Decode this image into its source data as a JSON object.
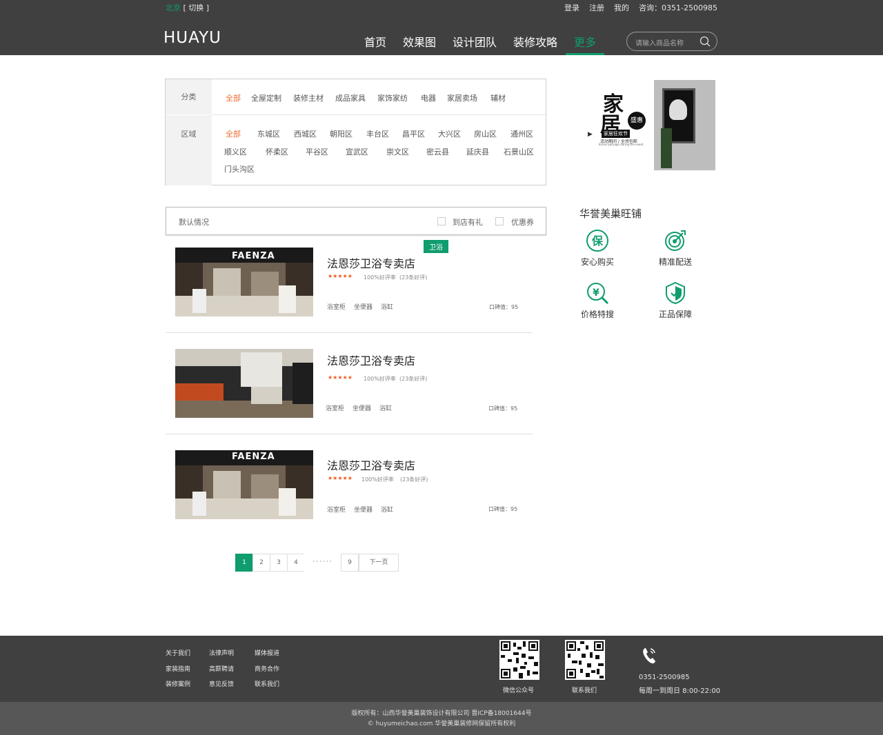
{
  "topbar": {
    "city": "北京",
    "switch": "[ 切换 ]",
    "login": "登录",
    "register": "注册",
    "mine": "我的",
    "phone": "咨询：0351-2500985"
  },
  "header": {
    "logo": "HUAYU",
    "nav": [
      "首页",
      "效果图",
      "设计团队",
      "装修攻略",
      "更多"
    ],
    "search_placeholder": "请输入商品名称"
  },
  "filter": {
    "category_label": "分类",
    "categories": [
      "全部",
      "全屋定制",
      "装修主材",
      "成品家具",
      "家饰家纺",
      "电器",
      "家居卖场",
      "辅材"
    ],
    "area_label": "区域",
    "areas": [
      "全部",
      "东城区",
      "西城区",
      "朝阳区",
      "丰台区",
      "昌平区",
      "大兴区",
      "房山区",
      "通州区",
      "顺义区",
      "怀柔区",
      "平谷区",
      "宣武区",
      "崇文区",
      "密云县",
      "延庆县",
      "石景山区",
      "门头沟区"
    ]
  },
  "sortbar": {
    "default": "默认情况",
    "opt1": "到店有礼",
    "opt2": "优惠券"
  },
  "stores": [
    {
      "name": "法恩莎卫浴专卖店",
      "tag": "卫浴",
      "stars": "★★★★★",
      "rate": "100%好评率",
      "reviews": "(23条好评)",
      "cats": [
        "浴室柜",
        "坐便器",
        "浴缸"
      ],
      "score": "口碑值：95"
    },
    {
      "name": "法恩莎卫浴专卖店",
      "tag": "",
      "stars": "★★★★★",
      "rate": "100%好评率",
      "reviews": "(23条好评)",
      "cats": [
        "浴室柜",
        "坐便器",
        "浴缸"
      ],
      "score": "口碑值：95"
    },
    {
      "name": "法恩莎卫浴专卖店",
      "tag": "",
      "stars": "★★★★★",
      "rate": "100%好评率",
      "reviews": "(23条好评)",
      "cats": [
        "浴室柜",
        "坐便器",
        "浴缸"
      ],
      "score": "口碑值：95"
    }
  ],
  "store_sign": "FAENZA",
  "pager": {
    "pages": [
      "1",
      "2",
      "3",
      "4"
    ],
    "gap": "······",
    "last": "9",
    "next": "下一页"
  },
  "ad": {
    "line1": "家",
    "line2": "居",
    "badge": "盛惠",
    "slogan": "家居狂欢节",
    "sub": "活动期间 / 全场包邮",
    "sub2": "Entire package during the event"
  },
  "shop": {
    "title": "华誉美巢旺铺",
    "features": [
      "安心购买",
      "精准配送",
      "价格特搜",
      "正品保障"
    ],
    "icon_char1": "保",
    "icon_char2": "¥"
  },
  "footer": {
    "links": [
      "关于我们",
      "法律声明",
      "媒体报道",
      "家装指南",
      "高薪聘请",
      "商务合作",
      "装修案例",
      "意见反馈",
      "联系我们"
    ],
    "qr1": "微信公众号",
    "qr2": "联系我们",
    "phone": "0351-2500985",
    "hours": "每周一到周日 8:00-22:00"
  },
  "copyright": {
    "line1": "版权所有：山西华誉美巢装饰设计有限公司 晋ICP备18001644号",
    "line2": "© huyumeichao.com 华誉美巢装修网保留所有权利"
  },
  "colors": {
    "accent": "#0f9c6e",
    "orange": "#ee6c2d",
    "dark": "#404040"
  }
}
